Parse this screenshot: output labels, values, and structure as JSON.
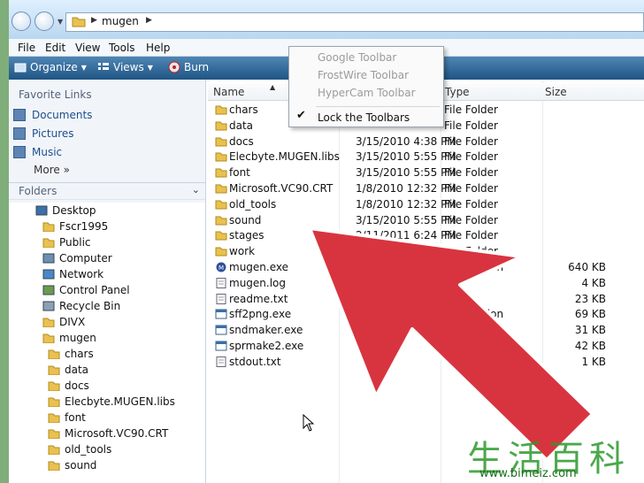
{
  "address_bar": {
    "path": "mugen"
  },
  "menu": [
    "File",
    "Edit",
    "View",
    "Tools",
    "Help"
  ],
  "toolbar": {
    "organize": "Organize",
    "views": "Views",
    "burn": "Burn"
  },
  "nav": {
    "favorite_links_title": "Favorite Links",
    "favorites": [
      "Documents",
      "Pictures",
      "Music"
    ],
    "more": "More",
    "folders_title": "Folders",
    "tree": [
      {
        "label": "Desktop",
        "icon": "desktop-icon"
      },
      {
        "label": "Fscr1995",
        "icon": "folder-icon"
      },
      {
        "label": "Public",
        "icon": "folder-icon"
      },
      {
        "label": "Computer",
        "icon": "computer-icon"
      },
      {
        "label": "Network",
        "icon": "network-icon"
      },
      {
        "label": "Control Panel",
        "icon": "control-panel-icon"
      },
      {
        "label": "Recycle Bin",
        "icon": "recycle-bin-icon"
      },
      {
        "label": "DIVX",
        "icon": "folder-icon"
      },
      {
        "label": "mugen",
        "icon": "folder-open-icon"
      },
      {
        "label": "chars",
        "icon": "folder-icon"
      },
      {
        "label": "data",
        "icon": "folder-icon"
      },
      {
        "label": "docs",
        "icon": "folder-icon"
      },
      {
        "label": "Elecbyte.MUGEN.libs",
        "icon": "folder-icon"
      },
      {
        "label": "font",
        "icon": "folder-icon"
      },
      {
        "label": "Microsoft.VC90.CRT",
        "icon": "folder-icon"
      },
      {
        "label": "old_tools",
        "icon": "folder-icon"
      },
      {
        "label": "sound",
        "icon": "folder-icon"
      }
    ]
  },
  "columns": {
    "name": "Name",
    "type": "Type",
    "size": "Size"
  },
  "files": [
    {
      "name": "chars",
      "date": "",
      "type": "File Folder",
      "size": "",
      "icon": "folder-icon"
    },
    {
      "name": "data",
      "date": "",
      "type": "File Folder",
      "size": "",
      "icon": "folder-icon"
    },
    {
      "name": "docs",
      "date": "3/15/2010 4:38 PM",
      "type": "File Folder",
      "size": "",
      "icon": "folder-icon"
    },
    {
      "name": "Elecbyte.MUGEN.libs",
      "date": "3/15/2010 5:55 PM",
      "type": "File Folder",
      "size": "",
      "icon": "folder-icon"
    },
    {
      "name": "font",
      "date": "3/15/2010 5:55 PM",
      "type": "File Folder",
      "size": "",
      "icon": "folder-icon"
    },
    {
      "name": "Microsoft.VC90.CRT",
      "date": "1/8/2010 12:32 PM",
      "type": "File Folder",
      "size": "",
      "icon": "folder-icon"
    },
    {
      "name": "old_tools",
      "date": "1/8/2010 12:32 PM",
      "type": "File Folder",
      "size": "",
      "icon": "folder-icon"
    },
    {
      "name": "sound",
      "date": "3/15/2010 5:55 PM",
      "type": "File Folder",
      "size": "",
      "icon": "folder-icon"
    },
    {
      "name": "stages",
      "date": "2/11/2011 6:24 PM",
      "type": "File Folder",
      "size": "",
      "icon": "folder-icon"
    },
    {
      "name": "work",
      "date": "",
      "type": "File Folder",
      "size": "",
      "icon": "folder-icon"
    },
    {
      "name": "mugen.exe",
      "date": "",
      "type": "Application",
      "size": "640 KB",
      "icon": "mugen-app-icon"
    },
    {
      "name": "mugen.log",
      "date": "",
      "type": "",
      "size": "4 KB",
      "icon": "text-file-icon"
    },
    {
      "name": "readme.txt",
      "date": "",
      "type": "",
      "size": "23 KB",
      "icon": "text-file-icon"
    },
    {
      "name": "sff2png.exe",
      "date": "",
      "type": "Application",
      "size": "69 KB",
      "icon": "app-icon"
    },
    {
      "name": "sndmaker.exe",
      "date": "",
      "type": "",
      "size": "31 KB",
      "icon": "app-icon"
    },
    {
      "name": "sprmake2.exe",
      "date": "",
      "type": "",
      "size": "42 KB",
      "icon": "app-icon"
    },
    {
      "name": "stdout.txt",
      "date": "",
      "type": "",
      "size": "1 KB",
      "icon": "text-file-icon"
    }
  ],
  "context_menu": {
    "items": [
      {
        "label": "Google Toolbar",
        "enabled": false
      },
      {
        "label": "FrostWire Toolbar",
        "enabled": false
      },
      {
        "label": "HyperCam Toolbar",
        "enabled": false
      },
      {
        "label": "Lock the Toolbars",
        "enabled": true,
        "checked": true
      }
    ]
  },
  "watermark": {
    "chinese": "生活百科",
    "url": "www.bimeiz.com"
  },
  "colors": {
    "arrow": "#d8343f",
    "toolbar": "#2b6295",
    "folder": "#e9c14e",
    "page_bg": "#7fae7a"
  }
}
